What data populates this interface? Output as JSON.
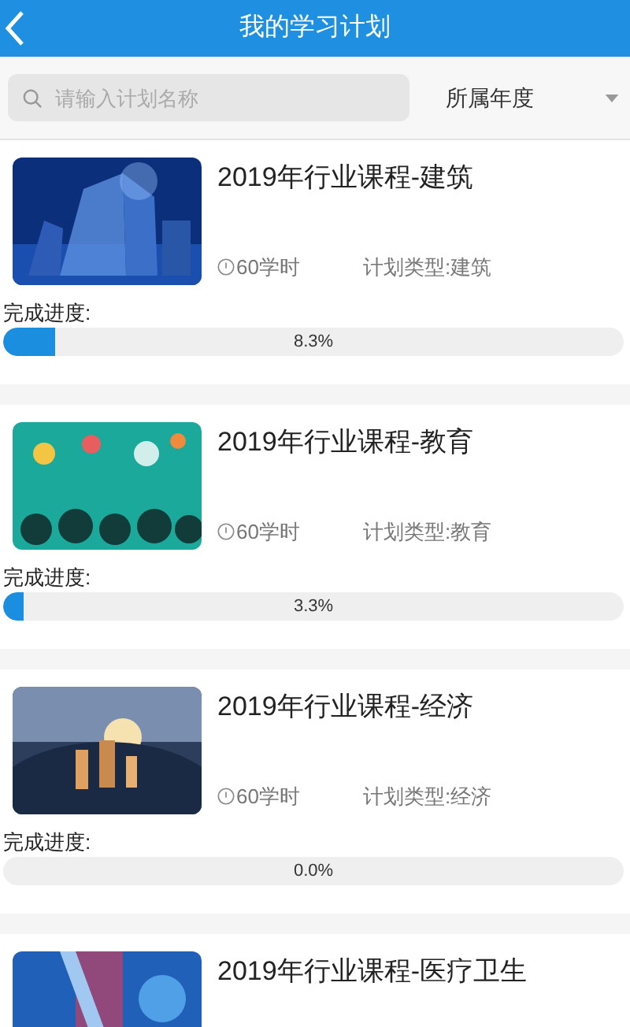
{
  "header": {
    "title": "我的学习计划"
  },
  "search": {
    "placeholder": "请输入计划名称"
  },
  "year_filter": {
    "label": "所属年度"
  },
  "plans": [
    {
      "title": "2019年行业课程-建筑",
      "hours": "60学时",
      "type": "计划类型:建筑",
      "progress_label": "完成进度:",
      "level": 0.083,
      "percent": "8.3%"
    },
    {
      "title": "2019年行业课程-教育",
      "hours": "60学时",
      "type": "计划类型:教育",
      "progress_label": "完成进度:",
      "level": 0.033,
      "percent": "3.3%"
    },
    {
      "title": "2019年行业课程-经济",
      "hours": "60学时",
      "type": "计划类型:经济",
      "progress_label": "完成进度:",
      "level": 0,
      "percent": "0.0%"
    },
    {
      "title": "2019年行业课程-医疗卫生"
    }
  ]
}
